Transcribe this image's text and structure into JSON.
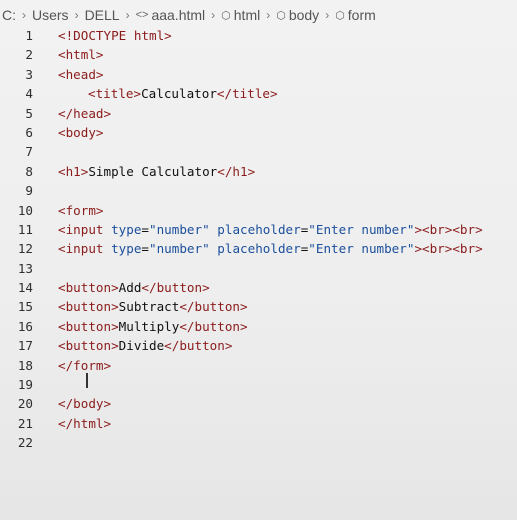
{
  "breadcrumb": [
    {
      "label": "C:",
      "icon": null
    },
    {
      "label": "Users",
      "icon": null
    },
    {
      "label": "DELL",
      "icon": null
    },
    {
      "label": "aaa.html",
      "icon": "code-brackets-icon"
    },
    {
      "label": "html",
      "icon": "cube-icon"
    },
    {
      "label": "body",
      "icon": "cube-icon"
    },
    {
      "label": "form",
      "icon": "cube-icon"
    }
  ],
  "colors": {
    "tag": "#8b1b1b",
    "attr": "#1b4f9c",
    "text": "#111111"
  },
  "editor": {
    "lines": [
      {
        "n": "1",
        "indent": 0,
        "tokens": [
          [
            "tag",
            "<!DOCTYPE html>"
          ]
        ]
      },
      {
        "n": "2",
        "indent": 0,
        "tokens": [
          [
            "tag",
            "<html>"
          ]
        ]
      },
      {
        "n": "3",
        "indent": 0,
        "tokens": [
          [
            "tag",
            "<head>"
          ]
        ]
      },
      {
        "n": "4",
        "indent": 1,
        "tokens": [
          [
            "tag",
            "<title>"
          ],
          [
            "txt",
            "Calculator"
          ],
          [
            "tag",
            "</title>"
          ]
        ]
      },
      {
        "n": "5",
        "indent": 0,
        "tokens": [
          [
            "tag",
            "</head>"
          ]
        ]
      },
      {
        "n": "6",
        "indent": 0,
        "tokens": [
          [
            "tag",
            "<body>"
          ]
        ]
      },
      {
        "n": "7",
        "indent": 0,
        "tokens": []
      },
      {
        "n": "8",
        "indent": 0,
        "tokens": [
          [
            "tag",
            "<h1>"
          ],
          [
            "txt",
            "Simple Calculator"
          ],
          [
            "tag",
            "</h1>"
          ]
        ]
      },
      {
        "n": "9",
        "indent": 0,
        "tokens": []
      },
      {
        "n": "10",
        "indent": 0,
        "tokens": [
          [
            "tag",
            "<form>"
          ]
        ]
      },
      {
        "n": "11",
        "indent": 0,
        "tokens": [
          [
            "tag",
            "<input "
          ],
          [
            "attr",
            "type"
          ],
          [
            "txt",
            "="
          ],
          [
            "str",
            "\"number\""
          ],
          [
            "txt",
            " "
          ],
          [
            "attr",
            "placeholder"
          ],
          [
            "txt",
            "="
          ],
          [
            "str",
            "\"Enter number\""
          ],
          [
            "tag",
            "><br><br>"
          ]
        ]
      },
      {
        "n": "12",
        "indent": 0,
        "tokens": [
          [
            "tag",
            "<input "
          ],
          [
            "attr",
            "type"
          ],
          [
            "txt",
            "="
          ],
          [
            "str",
            "\"number\""
          ],
          [
            "txt",
            " "
          ],
          [
            "attr",
            "placeholder"
          ],
          [
            "txt",
            "="
          ],
          [
            "str",
            "\"Enter number\""
          ],
          [
            "tag",
            "><br><br>"
          ]
        ]
      },
      {
        "n": "13",
        "indent": 0,
        "tokens": []
      },
      {
        "n": "14",
        "indent": 0,
        "tokens": [
          [
            "tag",
            "<button>"
          ],
          [
            "txt",
            "Add"
          ],
          [
            "tag",
            "</button>"
          ]
        ]
      },
      {
        "n": "15",
        "indent": 0,
        "tokens": [
          [
            "tag",
            "<button>"
          ],
          [
            "txt",
            "Subtract"
          ],
          [
            "tag",
            "</button>"
          ]
        ]
      },
      {
        "n": "16",
        "indent": 0,
        "tokens": [
          [
            "tag",
            "<button>"
          ],
          [
            "txt",
            "Multiply"
          ],
          [
            "tag",
            "</button>"
          ]
        ]
      },
      {
        "n": "17",
        "indent": 0,
        "tokens": [
          [
            "tag",
            "<button>"
          ],
          [
            "txt",
            "Divide"
          ],
          [
            "tag",
            "</button>"
          ]
        ]
      },
      {
        "n": "18",
        "indent": 0,
        "tokens": [
          [
            "tag",
            "</form>"
          ]
        ]
      },
      {
        "n": "19",
        "indent": 0,
        "tokens": []
      },
      {
        "n": "20",
        "indent": 0,
        "tokens": [
          [
            "tag",
            "</body>"
          ]
        ]
      },
      {
        "n": "21",
        "indent": 0,
        "tokens": [
          [
            "tag",
            "</html>"
          ]
        ]
      },
      {
        "n": "22",
        "indent": 0,
        "tokens": []
      }
    ]
  }
}
